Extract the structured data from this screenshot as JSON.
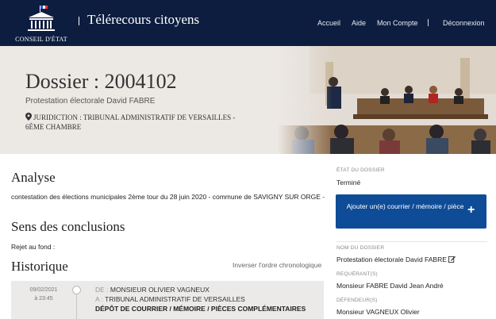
{
  "header": {
    "logo_text": "CONSEIL D'ÉTAT",
    "brand": "Télérecours citoyens",
    "nav": [
      {
        "label": "Accueil"
      },
      {
        "label": "Aide"
      },
      {
        "label": "Mon Compte"
      },
      {
        "label": "Déconnexion"
      }
    ]
  },
  "hero": {
    "title": "Dossier : 2004102",
    "subtitle": "Protestation électorale David FABRE",
    "juridiction": "JURIDICTION : TRIBUNAL ADMINISTRATIF DE VERSAILLES - 6ÈME CHAMBRE"
  },
  "main": {
    "analyse_heading": "Analyse",
    "analyse_text": "contestation des élections municipales 2ème tour du 28 juin 2020 - commune de SAVIGNY SUR ORGE -",
    "sens_heading": "Sens des conclusions",
    "sens_text": "Rejet au fond :",
    "historique_heading": "Historique",
    "invert_label": "Inverser l'ordre chronologique",
    "timeline": [
      {
        "date": "09/02/2021",
        "time": "à 23:45",
        "de_label": "DE :",
        "de": "MONSIEUR OLIVIER VAGNEUX",
        "a_label": "A :",
        "a": "TRIBUNAL ADMINISTRATIF DE VERSAILLES",
        "type": "DÉPÔT DE COURRIER / MÉMOIRE / PIÈCES COMPLÉMENTAIRES"
      }
    ]
  },
  "sidebar": {
    "etat_label": "ÉTAT DU DOSSIER",
    "etat_value": "Terminé",
    "cta_label": "Ajouter un(e) courrier / mémoire / pièce",
    "cta_plus": "+",
    "nom_label": "NOM DU DOSSIER",
    "nom_value": "Protestation électorale David FABRE",
    "requerant_label": "REQUÉRANT(S)",
    "requerant_value": "Monsieur FABRE David Jean André",
    "defendeur_label": "DÉFENDEUR(S)",
    "defendeur_value": "Monsieur VAGNEUX Olivier"
  },
  "colors": {
    "header_bg": "#0d1d3f",
    "cta_bg": "#0f4c97",
    "hero_bg": "#ece8e4"
  },
  "icons": {
    "juridiction": "map-pin-icon",
    "edit": "edit-icon",
    "logo": "marianne-building-icon"
  }
}
